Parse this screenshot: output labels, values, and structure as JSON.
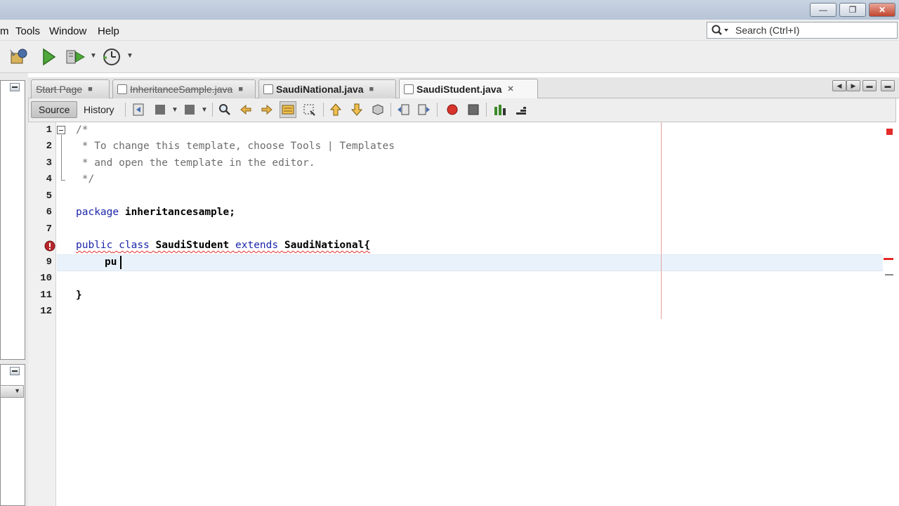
{
  "window": {
    "controls": [
      "minimize",
      "maximize",
      "close"
    ]
  },
  "menu": {
    "items": [
      "m",
      "Tools",
      "Window",
      "Help"
    ]
  },
  "search": {
    "placeholder": "Search (Ctrl+I)"
  },
  "tabs": [
    {
      "label": "Start Page",
      "active": false
    },
    {
      "label": "InheritanceSample.java",
      "active": false
    },
    {
      "label": "SaudiNational.java",
      "active": false
    },
    {
      "label": "SaudiStudent.java",
      "active": true
    }
  ],
  "editor_toolbar": {
    "source_label": "Source",
    "history_label": "History"
  },
  "editor": {
    "line_numbers": [
      "1",
      "2",
      "3",
      "4",
      "5",
      "6",
      "7",
      "8",
      "9",
      "10",
      "11",
      "12"
    ],
    "lines": {
      "l1": "/*",
      "l2": " * To change this template, choose Tools | Templates",
      "l3": " * and open the template in the editor.",
      "l4": " */",
      "l6_kw": "package",
      "l6_rest": " inheritancesample;",
      "l8_kw1": "public",
      "l8_kw2": "class",
      "l8_name": "SaudiStudent",
      "l8_kw3": "extends",
      "l8_parent": "SaudiNational{",
      "l9": "pu",
      "l11": "}"
    },
    "error_line": "8",
    "current_line": "9"
  },
  "colors": {
    "keyword": "#1c25a8",
    "comment": "#6d6d6d",
    "error": "#e42a2a",
    "current_line_bg": "#e9f2fb"
  }
}
